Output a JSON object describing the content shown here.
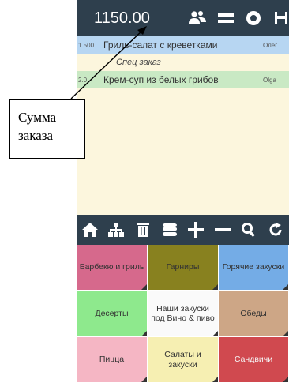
{
  "header": {
    "total": "1150.00",
    "icons": [
      "users-icon",
      "menu-icon",
      "settings-icon",
      "save-icon"
    ]
  },
  "order": {
    "rows": [
      {
        "qty": "1.500",
        "name": "Гриль-салат с креветками",
        "waiter": "Олег",
        "color": "#b7d6f2"
      },
      {
        "special": "Спец заказ"
      },
      {
        "qty": "2.0",
        "name": "Крем-суп из белых грибов",
        "waiter": "Olga",
        "color": "#c9e9c4"
      }
    ]
  },
  "toolbar": {
    "icons": [
      "home-icon",
      "hierarchy-icon",
      "trash-icon",
      "database-icon",
      "plus-icon",
      "minus-icon",
      "search-icon",
      "refresh-icon"
    ]
  },
  "categories": [
    {
      "label": "Барбекю и гриль",
      "color": "#d6698c"
    },
    {
      "label": "Гарниры",
      "color": "#88811f"
    },
    {
      "label": "Горячие закуски",
      "color": "#74ace6"
    },
    {
      "label": "Десерты",
      "color": "#8ee98d"
    },
    {
      "label": "Наши закуски под Вино & пиво",
      "color": "#fafafa"
    },
    {
      "label": "Обеды",
      "color": "#cda686"
    },
    {
      "label": "Пицца",
      "color": "#f5b6c4"
    },
    {
      "label": "Салаты и закуски",
      "color": "#f6efb2"
    },
    {
      "label": "Сандвичи",
      "color": "#d0494f"
    }
  ],
  "annotation": {
    "line1": "Сумма",
    "line2": "заказа"
  },
  "colors": {
    "header_bg": "#2e3f4d",
    "order_bg": "#fcf6dd"
  }
}
